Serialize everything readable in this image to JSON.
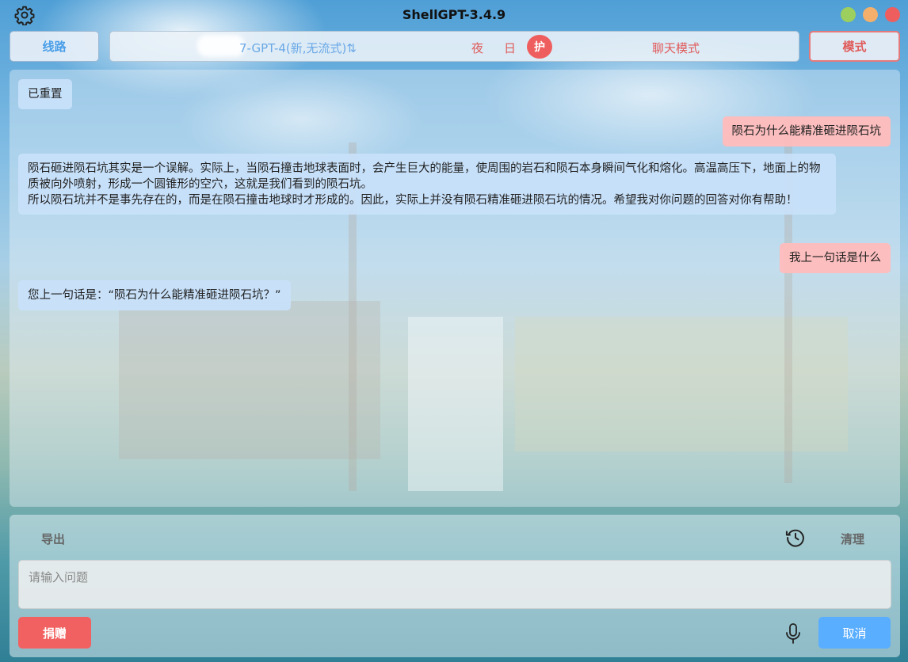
{
  "window": {
    "title": "ShellGPT-3.4.9",
    "icons": {
      "settings": "gear-icon",
      "traffic_lights": [
        "green",
        "orange",
        "red"
      ]
    }
  },
  "toolbar": {
    "route_label": "线路",
    "model_label": "7-GPT-4(新,无流式)⇅",
    "night_label": "夜",
    "day_label": "日",
    "guard_label": "护",
    "chat_mode_label": "聊天模式",
    "mode_label": "模式"
  },
  "messages": [
    {
      "role": "bot",
      "text": "已重置"
    },
    {
      "role": "user",
      "text": "陨石为什么能精准砸进陨石坑"
    },
    {
      "role": "bot",
      "text": "陨石砸进陨石坑其实是一个误解。实际上，当陨石撞击地球表面时，会产生巨大的能量，使周围的岩石和陨石本身瞬间气化和熔化。高温高压下，地面上的物质被向外喷射，形成一个圆锥形的空穴，这就是我们看到的陨石坑。\n所以陨石坑并不是事先存在的，而是在陨石撞击地球时才形成的。因此，实际上并没有陨石精准砸进陨石坑的情况。希望我对你问题的回答对你有帮助！"
    },
    {
      "role": "user",
      "text": "我上一句话是什么"
    },
    {
      "role": "bot",
      "text": "您上一句话是：“陨石为什么能精准砸进陨石坑？”"
    }
  ],
  "bottom": {
    "export_label": "导出",
    "clear_label": "清理",
    "input_placeholder": "请输入问题",
    "input_value": "",
    "donate_label": "捐赠",
    "cancel_label": "取消",
    "icons": {
      "history": "history-icon",
      "mic": "microphone-icon"
    }
  },
  "colors": {
    "accent_blue": "#4a9ee8",
    "accent_red": "#ef5e5e",
    "user_bubble": "#ffbcbc",
    "bot_bubble": "#c8e1fa",
    "cancel_button": "#5aaeff",
    "donate_button": "#f26161"
  }
}
